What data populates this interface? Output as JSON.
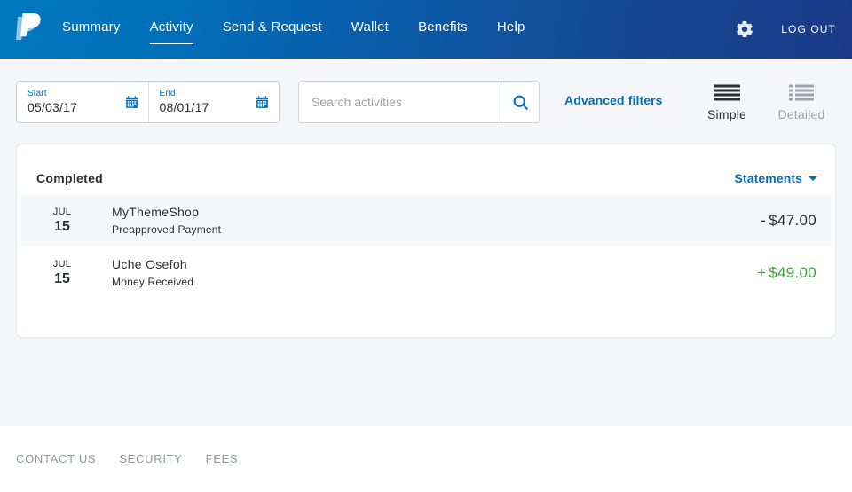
{
  "header": {
    "logo_name": "paypal-logo",
    "nav": [
      {
        "label": "Summary",
        "active": false
      },
      {
        "label": "Activity",
        "active": true
      },
      {
        "label": "Send & Request",
        "active": false
      },
      {
        "label": "Wallet",
        "active": false
      },
      {
        "label": "Benefits",
        "active": false
      },
      {
        "label": "Help",
        "active": false
      }
    ],
    "settings_icon": "gear-icon",
    "logout_label": "LOG OUT",
    "gradient_start": "#0070ba",
    "gradient_end": "#1a3a88"
  },
  "filters": {
    "start": {
      "label": "Start",
      "value": "05/03/17",
      "icon": "calendar-icon"
    },
    "end": {
      "label": "End",
      "value": "08/01/17",
      "icon": "calendar-icon"
    },
    "search": {
      "placeholder": "Search activities",
      "value": "",
      "icon": "search-icon"
    },
    "advanced_filters_label": "Advanced filters",
    "views": [
      {
        "label": "Simple",
        "icon": "simple-view-icon",
        "active": true
      },
      {
        "label": "Detailed",
        "icon": "detailed-view-icon",
        "active": false
      }
    ]
  },
  "activity": {
    "title": "Completed",
    "statements_label": "Statements",
    "statements_icon": "chevron-down-icon",
    "transactions": [
      {
        "month": "JUL",
        "day": "15",
        "name": "MyThemeShop",
        "type": "Preapproved Payment",
        "sign": "-",
        "amount": "$47.00",
        "direction": "debit",
        "shaded": true
      },
      {
        "month": "JUL",
        "day": "15",
        "name": "Uche Osefoh",
        "type": "Money Received",
        "sign": "+",
        "amount": "$49.00",
        "direction": "credit",
        "shaded": false
      }
    ]
  },
  "footer": {
    "links": [
      {
        "label": "CONTACT US"
      },
      {
        "label": "SECURITY"
      },
      {
        "label": "FEES"
      }
    ]
  },
  "colors": {
    "brand_blue": "#0070ba",
    "credit_green": "#3d9e3d",
    "page_bg": "#f5f6fa",
    "row_shade": "#f5f7fa"
  }
}
